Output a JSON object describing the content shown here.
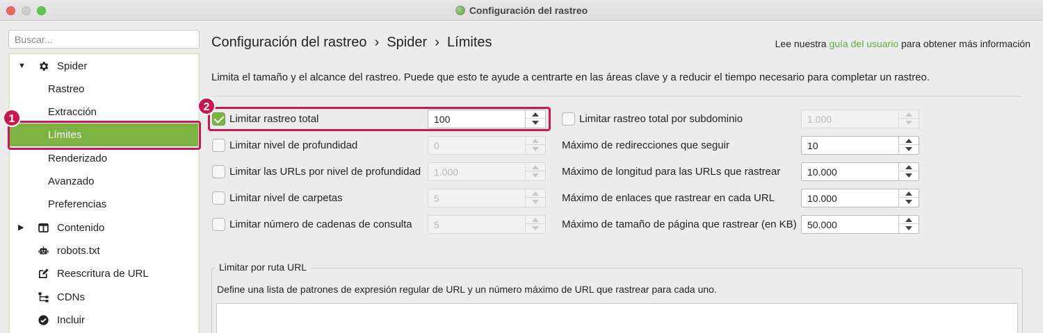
{
  "window": {
    "title": "Configuración del rastreo"
  },
  "sidebar": {
    "search_placeholder": "Buscar...",
    "items": [
      {
        "label": "Spider",
        "icon": "gear-icon",
        "level": 0,
        "expanded": true
      },
      {
        "label": "Rastreo",
        "level": 1
      },
      {
        "label": "Extracción",
        "level": 1
      },
      {
        "label": "Límites",
        "level": 1,
        "selected": true
      },
      {
        "label": "Renderizado",
        "level": 1
      },
      {
        "label": "Avanzado",
        "level": 1
      },
      {
        "label": "Preferencias",
        "level": 1
      },
      {
        "label": "Contenido",
        "icon": "columns-icon",
        "level": 0,
        "expanded": false
      },
      {
        "label": "robots.txt",
        "icon": "robot-icon",
        "level": 0
      },
      {
        "label": "Reescritura de URL",
        "icon": "edit-icon",
        "level": 0
      },
      {
        "label": "CDNs",
        "icon": "network-icon",
        "level": 0
      },
      {
        "label": "Incluir",
        "icon": "check-circle-icon",
        "level": 0
      }
    ]
  },
  "badges": {
    "one": "1",
    "two": "2"
  },
  "main": {
    "breadcrumb": "Configuración del rastreo  ›  Spider  ›  Límites",
    "help_prefix": "Lee nuestra ",
    "help_link": "guía del usuario",
    "help_suffix": " para obtener más información",
    "description": "Limita el tamaño y el alcance del rastreo. Puede que esto te ayude a centrarte en las áreas clave y a reducir el tiempo necesario para completar un rastreo.",
    "left_fields": [
      {
        "label": "Limitar rastreo total",
        "checked": true,
        "value": "100",
        "enabled": true
      },
      {
        "label": "Limitar nivel de profundidad",
        "checked": false,
        "value": "0",
        "enabled": false
      },
      {
        "label": "Limitar las URLs por nivel de profundidad",
        "checked": false,
        "value": "1.000",
        "enabled": false
      },
      {
        "label": "Limitar nivel de carpetas",
        "checked": false,
        "value": "5",
        "enabled": false
      },
      {
        "label": "Limitar número de cadenas de consulta",
        "checked": false,
        "value": "5",
        "enabled": false
      }
    ],
    "right_fields": [
      {
        "label": "Limitar rastreo total por subdominio",
        "checkbox": true,
        "checked": false,
        "value": "1.000",
        "enabled": false
      },
      {
        "label": "Máximo de redirecciones que seguir",
        "checkbox": false,
        "value": "10",
        "enabled": true
      },
      {
        "label": "Máximo de longitud para las URLs que rastrear",
        "checkbox": false,
        "value": "10.000",
        "enabled": true
      },
      {
        "label": "Máximo de enlaces que rastrear en cada URL",
        "checkbox": false,
        "value": "10.000",
        "enabled": true
      },
      {
        "label": "Máximo de tamaño de página que rastrear (en KB)",
        "checkbox": false,
        "value": "50.000",
        "enabled": true
      }
    ],
    "url_path_group": {
      "title": "Limitar por ruta URL",
      "description": "Define una lista de patrones de expresión regular de URL y un número máximo de URL que rastrear para cada uno."
    }
  },
  "colors": {
    "accent": "#7cb342",
    "highlight": "#c9174f",
    "link": "#6aa83b"
  }
}
